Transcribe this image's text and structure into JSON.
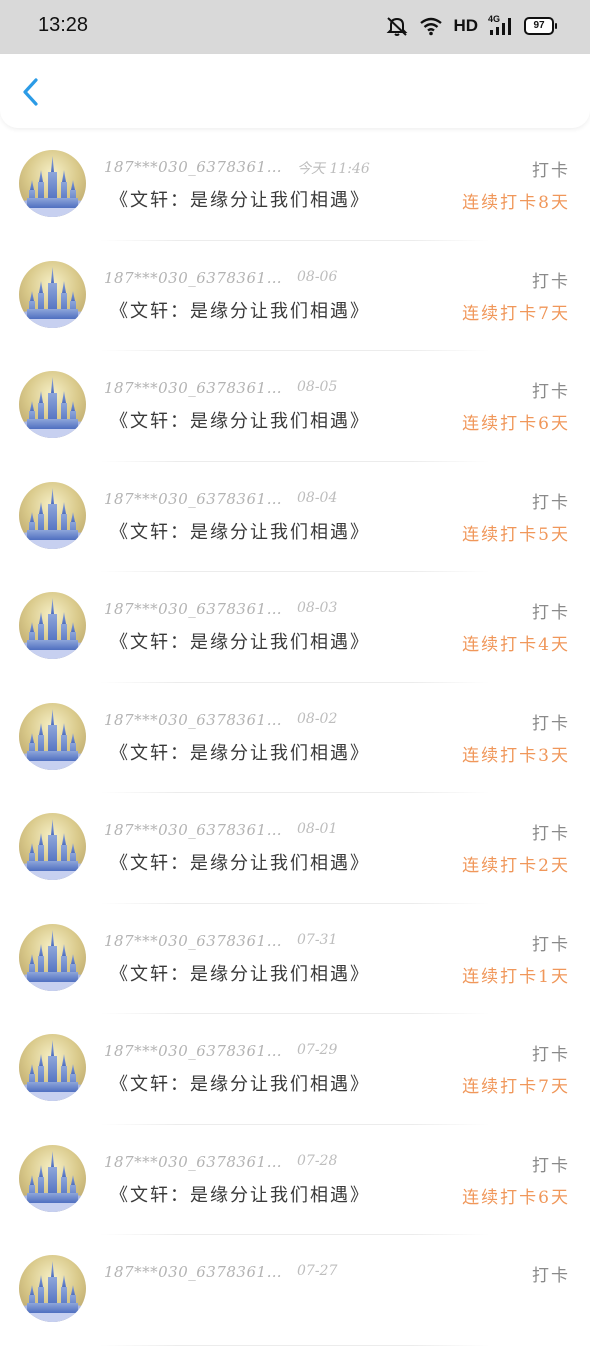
{
  "status_bar": {
    "time": "13:28",
    "network_label": "HD",
    "signal_label": "4G",
    "battery": "97",
    "icons": [
      "mute-bell-icon",
      "wifi-icon",
      "signal-icon",
      "battery-icon"
    ]
  },
  "nav": {
    "back_icon": "chevron-left-icon",
    "accent_color": "#2b9be6"
  },
  "colors": {
    "streak": "#f0975a",
    "muted_text": "#b3b3b3",
    "title_text": "#3a3a3a"
  },
  "records": [
    {
      "name": "187***030_6378361…",
      "date": "今天 11:46",
      "title": "《文轩：是缘分让我们相遇》",
      "type": "打卡",
      "streak": "连续打卡8天"
    },
    {
      "name": "187***030_6378361…",
      "date": "08-06",
      "title": "《文轩：是缘分让我们相遇》",
      "type": "打卡",
      "streak": "连续打卡7天"
    },
    {
      "name": "187***030_6378361…",
      "date": "08-05",
      "title": "《文轩：是缘分让我们相遇》",
      "type": "打卡",
      "streak": "连续打卡6天"
    },
    {
      "name": "187***030_6378361…",
      "date": "08-04",
      "title": "《文轩：是缘分让我们相遇》",
      "type": "打卡",
      "streak": "连续打卡5天"
    },
    {
      "name": "187***030_6378361…",
      "date": "08-03",
      "title": "《文轩：是缘分让我们相遇》",
      "type": "打卡",
      "streak": "连续打卡4天"
    },
    {
      "name": "187***030_6378361…",
      "date": "08-02",
      "title": "《文轩：是缘分让我们相遇》",
      "type": "打卡",
      "streak": "连续打卡3天"
    },
    {
      "name": "187***030_6378361…",
      "date": "08-01",
      "title": "《文轩：是缘分让我们相遇》",
      "type": "打卡",
      "streak": "连续打卡2天"
    },
    {
      "name": "187***030_6378361…",
      "date": "07-31",
      "title": "《文轩：是缘分让我们相遇》",
      "type": "打卡",
      "streak": "连续打卡1天"
    },
    {
      "name": "187***030_6378361…",
      "date": "07-29",
      "title": "《文轩：是缘分让我们相遇》",
      "type": "打卡",
      "streak": "连续打卡7天"
    },
    {
      "name": "187***030_6378361…",
      "date": "07-28",
      "title": "《文轩：是缘分让我们相遇》",
      "type": "打卡",
      "streak": "连续打卡6天"
    },
    {
      "name": "187***030_6378361…",
      "date": "07-27",
      "title": "",
      "type": "打卡",
      "streak": ""
    }
  ]
}
